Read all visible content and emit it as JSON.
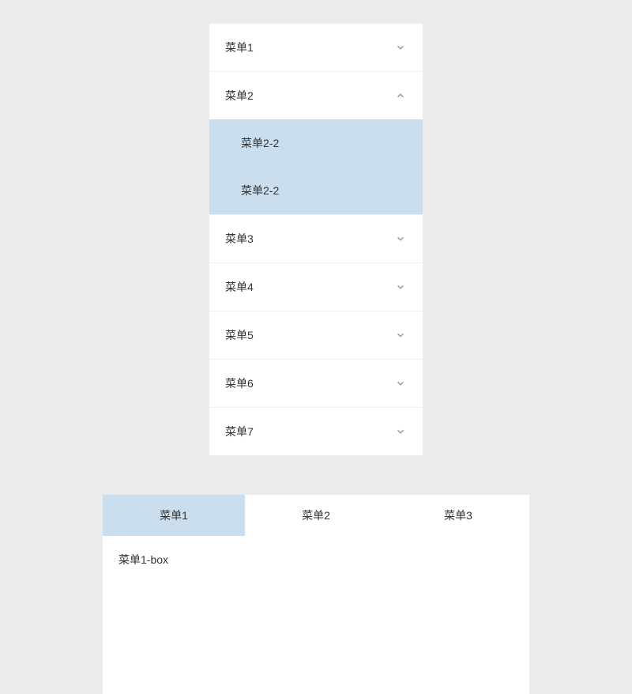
{
  "accordion": {
    "items": [
      {
        "label": "菜单1",
        "expanded": false,
        "children": []
      },
      {
        "label": "菜单2",
        "expanded": true,
        "children": [
          {
            "label": "菜单2-2"
          },
          {
            "label": "菜单2-2"
          }
        ]
      },
      {
        "label": "菜单3",
        "expanded": false,
        "children": []
      },
      {
        "label": "菜单4",
        "expanded": false,
        "children": []
      },
      {
        "label": "菜单5",
        "expanded": false,
        "children": []
      },
      {
        "label": "菜单6",
        "expanded": false,
        "children": []
      },
      {
        "label": "菜单7",
        "expanded": false,
        "children": []
      }
    ]
  },
  "tabs": {
    "items": [
      {
        "label": "菜单1",
        "active": true
      },
      {
        "label": "菜单2",
        "active": false
      },
      {
        "label": "菜单3",
        "active": false
      }
    ],
    "content": "菜单1-box"
  }
}
